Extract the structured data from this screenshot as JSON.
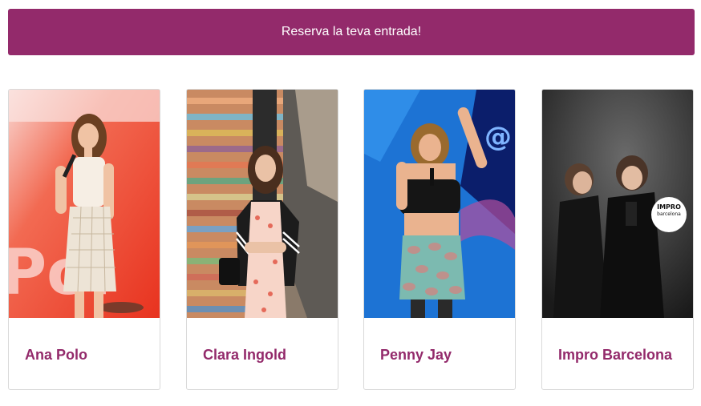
{
  "cta": {
    "label": "Reserva la teva entrada!"
  },
  "brand_color": "#932a6b",
  "performers": [
    {
      "name": "Ana Polo",
      "photo": "comedian-on-stage-photo"
    },
    {
      "name": "Clara Ingold",
      "photo": "woman-in-street-photo"
    },
    {
      "name": "Penny Jay",
      "photo": "comedian-singing-photo"
    },
    {
      "name": "Impro Barcelona",
      "photo": "two-women-laughing-photo",
      "logo_text": [
        "IMPRO",
        "barcelona"
      ]
    }
  ]
}
